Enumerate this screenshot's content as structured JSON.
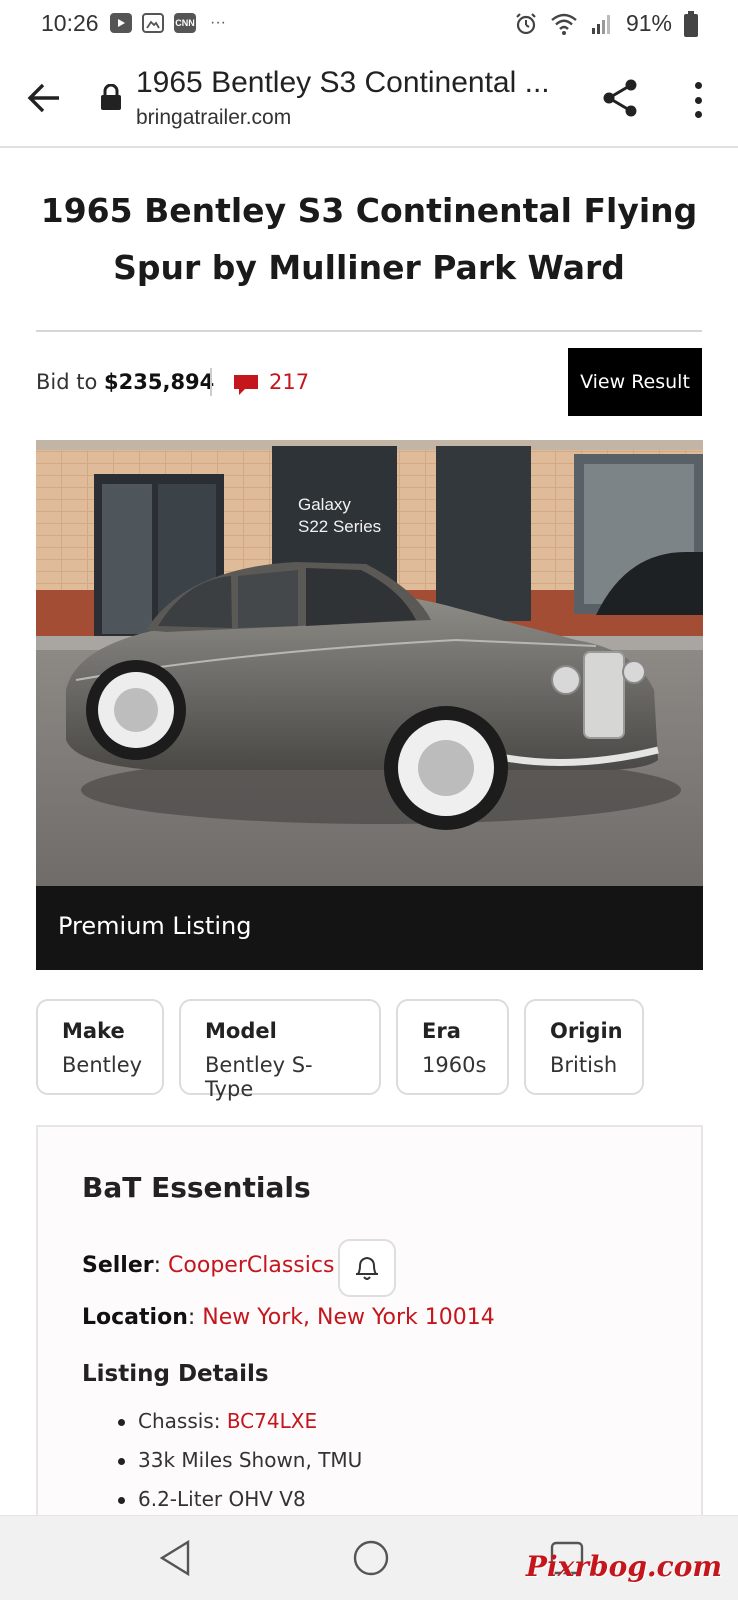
{
  "status_bar": {
    "time": "10:26",
    "notification_icons": [
      "youtube-icon",
      "gallery-icon",
      "cnn-icon"
    ],
    "cnn_label": "CNN",
    "more_notifications": "···",
    "battery": "91%"
  },
  "browser": {
    "page_title": "1965 Bentley S3 Continental ...",
    "domain": "bringatrailer.com"
  },
  "listing": {
    "title": "1965 Bentley S3 Continental Flying Spur by Mulliner Park Ward",
    "bid_prefix": "Bid to ",
    "bid_amount": "$235,894",
    "comment_count": "217",
    "view_result_label": "View Result",
    "premium_label": "Premium Listing",
    "photo_signage": [
      "Galaxy",
      "S22 Series"
    ]
  },
  "facts": [
    {
      "key": "Make",
      "value": "Bentley"
    },
    {
      "key": "Model",
      "value": "Bentley S-Type"
    },
    {
      "key": "Era",
      "value": "1960s"
    },
    {
      "key": "Origin",
      "value": "British"
    }
  ],
  "essentials": {
    "title": "BaT Essentials",
    "seller_label": "Seller",
    "seller_name": "CooperClassics",
    "location_label": "Location",
    "location_value": "New York, New York 10014",
    "details_title": "Listing Details",
    "chassis_label": "Chassis: ",
    "chassis_value": "BC74LXE",
    "details": [
      "33k Miles Shown, TMU",
      "6.2-Liter OHV V8"
    ]
  },
  "watermark": "Pixrbog.com",
  "colors": {
    "accent_red": "#c4161c",
    "premium_bar": "#141414"
  }
}
